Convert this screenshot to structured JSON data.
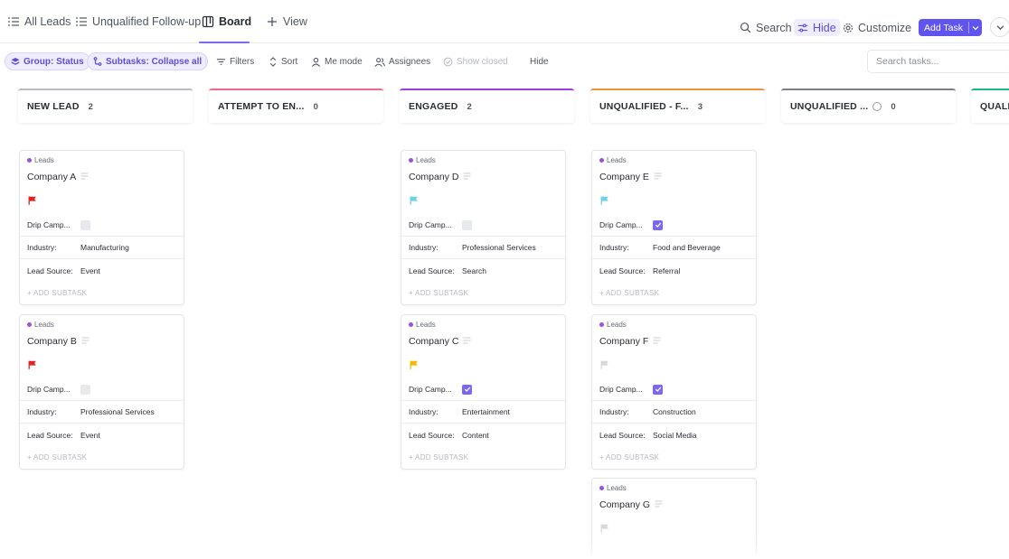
{
  "tabs": [
    {
      "label": "All Leads"
    },
    {
      "label": "Unqualified Follow-up"
    },
    {
      "label": "Board"
    },
    {
      "label": "View"
    }
  ],
  "topright": {
    "search": "Search",
    "hide": "Hide",
    "customize": "Customize",
    "add_task": "Add Task"
  },
  "filters": {
    "group": "Group: Status",
    "subtasks": "Subtasks: Collapse all",
    "filters": "Filters",
    "sort": "Sort",
    "me_mode": "Me mode",
    "assignees": "Assignees",
    "show_closed": "Show closed",
    "hide": "Hide",
    "search_placeholder": "Search tasks..."
  },
  "columns": [
    {
      "title": "NEW LEAD",
      "count": "2",
      "color": "#b9bcc2"
    },
    {
      "title": "ATTEMPT TO EN...",
      "count": "0",
      "color": "#f06a8a"
    },
    {
      "title": "ENGAGED",
      "count": "2",
      "color": "#a33be5"
    },
    {
      "title": "UNQUALIFIED - F...",
      "count": "3",
      "color": "#f0913b"
    },
    {
      "title": "UNQUALIFIED ...",
      "count": "0",
      "color": "#7b7f87"
    },
    {
      "title": "QUALIFI",
      "count": "",
      "color": "#1db98a"
    }
  ],
  "field_labels": {
    "drip": "Drip Camp...",
    "industry": "Industry:",
    "lead_source": "Lead Source:",
    "add_subtask": "+ ADD SUBTASK"
  },
  "cards": [
    {
      "list": "Leads",
      "name": "Company A",
      "flag_color": "#e02424",
      "drip": false,
      "industry": "Manufacturing",
      "lead_source": "Event"
    },
    {
      "list": "Leads",
      "name": "Company B",
      "flag_color": "#e02424",
      "drip": false,
      "industry": "Professional Services",
      "lead_source": "Event"
    },
    {
      "list": "Leads",
      "name": "Company D",
      "flag_color": "#6fd0e8",
      "drip": false,
      "industry": "Professional Services",
      "lead_source": "Search"
    },
    {
      "list": "Leads",
      "name": "Company C",
      "flag_color": "#f5b800",
      "drip": true,
      "industry": "Entertainment",
      "lead_source": "Content"
    },
    {
      "list": "Leads",
      "name": "Company E",
      "flag_color": "#6fd0e8",
      "drip": true,
      "industry": "Food and Beverage",
      "lead_source": "Referral"
    },
    {
      "list": "Leads",
      "name": "Company F",
      "flag_color": "#d6d8dc",
      "drip": true,
      "industry": "Construction",
      "lead_source": "Social Media"
    },
    {
      "list": "Leads",
      "name": "Company G",
      "flag_color": "#d6d8dc"
    }
  ],
  "colors": {
    "accent": "#7b68ee",
    "button": "#5f55ee",
    "leads_dot": "#9b51e0"
  }
}
